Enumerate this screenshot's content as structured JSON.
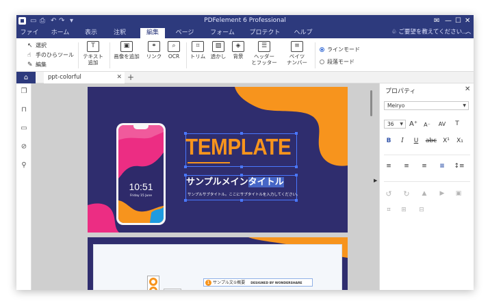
{
  "window": {
    "title": "PDFelement 6 Professional",
    "quick_access": [
      "↶",
      "↷",
      "▾"
    ],
    "controls": [
      "✉",
      "—",
      "☐",
      "✕"
    ]
  },
  "menu": {
    "items": [
      "ファイル",
      "ホーム",
      "表示",
      "注釈",
      "編集",
      "ページ",
      "フォーム",
      "プロテクト",
      "ヘルプ"
    ],
    "active": "編集",
    "tell_me": "ご要望を教えてください...",
    "collapse": "︿"
  },
  "ribbon": {
    "mode_tools": [
      "選択",
      "手のひらツール",
      "編集"
    ],
    "buttons": [
      {
        "label1": "テキスト",
        "label2": "追加",
        "icon": "T"
      },
      {
        "label1": "画像を追加",
        "label2": "",
        "icon": "▣"
      },
      {
        "label1": "リンク",
        "label2": "",
        "icon": "⚭"
      },
      {
        "label1": "OCR",
        "label2": "",
        "icon": "⌕"
      },
      {
        "label1": "トリム",
        "label2": "",
        "icon": "⌗"
      },
      {
        "label1": "透かし",
        "label2": "",
        "icon": "▨"
      },
      {
        "label1": "背景",
        "label2": "",
        "icon": "◈"
      },
      {
        "label1": "ヘッダー",
        "label2": "とフッター",
        "icon": "☰"
      },
      {
        "label1": "ベイツ",
        "label2": "ナンバー",
        "icon": "≡"
      }
    ],
    "modes": [
      "ラインモード",
      "段落モード"
    ],
    "selected_mode": "ラインモード"
  },
  "tabs": {
    "home_icon": "⌂",
    "document_tab": "ppt-colorful",
    "close": "✕",
    "add": "+"
  },
  "left_rail": {
    "icons": [
      "pages-icon",
      "bookmark-icon",
      "comment-icon",
      "attachment-icon",
      "search-icon"
    ],
    "glyphs": [
      "❐",
      "⊓",
      "▭",
      "⊘",
      "⚲"
    ]
  },
  "slide": {
    "title": "TEMPLATE",
    "subtitle_plain": "サンプルメイン",
    "subtitle_selected": "タイトル",
    "subtext": "サンプルサブタイトル。ここにサブタイトルを入力してください。",
    "phone_time": "10:51",
    "phone_date": "Friday 15 June"
  },
  "slide2": {
    "item_num": "1",
    "item_title": "サンプル文①概要",
    "item_credit": "DESIGNED BY WONDERSHARE"
  },
  "properties": {
    "title": "プロパティ",
    "close": "✕",
    "font": "Meiryo",
    "size": "36",
    "font_buttons": [
      "A⁺",
      "A⁻",
      "AV",
      "T"
    ],
    "style_buttons": [
      "B",
      "I",
      "U",
      "abc",
      "X¹",
      "X₁"
    ],
    "align_buttons": [
      "≡",
      "≡",
      "≡",
      "≡",
      "↕≡"
    ],
    "object_buttons": [
      "↺",
      "↻",
      "▲",
      "▶",
      "▣"
    ],
    "arrange_buttons": [
      "⌗",
      "⊞",
      "⊟"
    ]
  },
  "colors": {
    "brand": "#2d3a7d",
    "slide_bg": "#2f2d6e",
    "accent_orange": "#f7941d",
    "accent_pink": "#ec2d83",
    "selection": "#4a78ff"
  }
}
